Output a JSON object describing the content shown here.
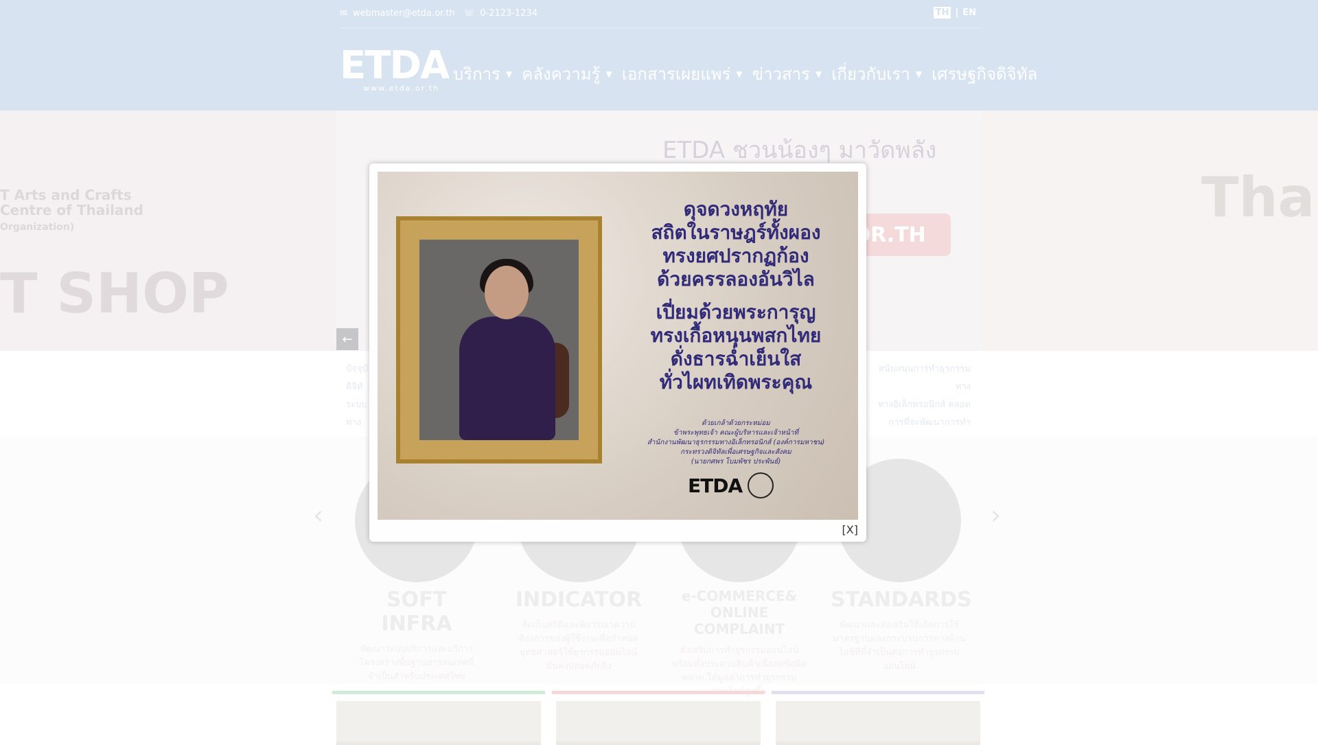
{
  "header": {
    "email": "webmaster@etda.or.th",
    "phone": "0-2123-1234",
    "lang_th": "TH",
    "lang_separator": "|",
    "lang_en": "EN",
    "logo_text": "ETDA",
    "logo_sub": "www.etda.or.th",
    "nav": [
      {
        "label": "บริการ"
      },
      {
        "label": "คลังความรู้"
      },
      {
        "label": "เอกสารเผยแพร่"
      },
      {
        "label": "ข่าวสาร"
      },
      {
        "label": "เกี่ยวกับเรา"
      },
      {
        "label": "เศรษฐกิจดิจิทัล"
      }
    ]
  },
  "banner": {
    "left_line1": "T Arts and Crafts",
    "left_line2": "Centre of Thailand",
    "left_line3": "Organization)",
    "left_big": "T SHOP",
    "center_heading": "ETDA ชวนน้องๆ มาวัดพลัง",
    "center_pill": ".OR.TH",
    "right_big": "Tha"
  },
  "strip": {
    "left_text": [
      "ปัจจุบั",
      "ดิจิทั",
      "ระบบ",
      "ทาง"
    ],
    "right_text": [
      "สนับสนุนการทำธุรกรรมทาง",
      "ทางอิเล็กทรอนิกส์ ตลอด",
      "การที่จะพัฒนาการทำธุรกรรม",
      ""
    ]
  },
  "services": [
    {
      "title": "SOFT INFRA",
      "desc": "พัฒนาระบบบริการและบริการโครงสร้างพื้นฐานสารสนเทศที่จำเป็นสำหรับประเทศไทย"
    },
    {
      "title": "INDICATOR",
      "desc": "จัดเก็บสถิติและพิจารณาความต้องการของผู้ใช้งานเพื่อกำหนดยุทธศาสตร์ให้ธุรกรรมออนไลน์มั่นคงปลอดภัยยิ่ง"
    },
    {
      "title": "e-COMMERCE& ONLINE COMPLAINT",
      "desc": "ส่งเสริมการทำธุรกรรมออนไลน์ พร้อมทั้งประสานสินค้าเพื่อลดข้อผิดพลาด ให้มูลค่าการทำธุรกรรมออนไลน์สูงขึ้น"
    },
    {
      "title": "STANDARDS",
      "desc": "พัฒนาและส่งเสริมให้เกิดการใช้มาตรฐานและกระบวนการทางด้านไอซีทีที่จำเป็นต่อการทำธุรกรรมออนไลน์"
    }
  ],
  "modal": {
    "poem": [
      "ดุจดวงหฤทัย",
      "สถิตในราษฎร์ทั้งผอง",
      "ทรงยศปรากฏก้อง",
      "ด้วยครรลองอันวิไล",
      "",
      "เปี่ยมด้วยพระการุญ",
      "ทรงเกื้อหนุนพสกไทย",
      "ดั่งธารฉ่ำเย็นใส",
      "ทั่วไผทเทิดพระคุณ"
    ],
    "credits": [
      "ด้วยเกล้าด้วยกระหม่อม",
      "ข้าพระพุทธเจ้า คณะผู้บริหารและเจ้าหน้าที่",
      "สำนักงานพัฒนาธุรกรรมทางอิเล็กทรอนิกส์ (องค์การมหาชน)",
      "กระทรวงดิจิทัลเพื่อเศรษฐกิจและสังคม",
      "(นายกศพร โบมพัชร ประพันธ์)"
    ],
    "logo_text": "ETDA",
    "close_label": "[X]"
  },
  "colors": {
    "header_bg": "#c2d4e9",
    "poem_color": "#312a78",
    "card_green": "#b7e0c0",
    "card_red": "#f2c4c2",
    "card_purple": "#d2d0e8"
  }
}
